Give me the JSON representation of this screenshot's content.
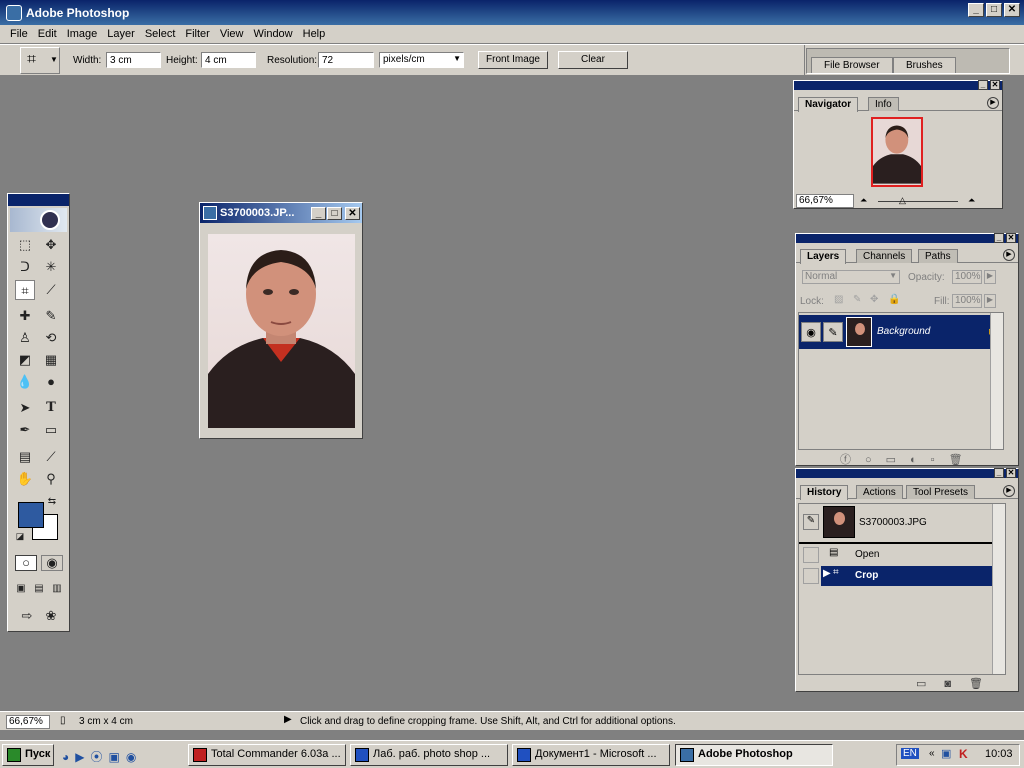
{
  "app": {
    "title": "Adobe Photoshop"
  },
  "menu": [
    "File",
    "Edit",
    "Image",
    "Layer",
    "Select",
    "Filter",
    "View",
    "Window",
    "Help"
  ],
  "options": {
    "width_label": "Width:",
    "width_value": "3 cm",
    "height_label": "Height:",
    "height_value": "4 cm",
    "resolution_label": "Resolution:",
    "resolution_value": "72",
    "units": "pixels/cm",
    "front_image": "Front Image",
    "clear": "Clear"
  },
  "well": {
    "file_browser": "File Browser",
    "brushes": "Brushes"
  },
  "navigator": {
    "tab_navigator": "Navigator",
    "tab_info": "Info",
    "zoom": "66,67%"
  },
  "layers": {
    "tab_layers": "Layers",
    "tab_channels": "Channels",
    "tab_paths": "Paths",
    "blend_mode": "Normal",
    "opacity_label": "Opacity:",
    "opacity_value": "100%",
    "lock_label": "Lock:",
    "fill_label": "Fill:",
    "fill_value": "100%",
    "layer_name": "Background"
  },
  "history": {
    "tab_history": "History",
    "tab_actions": "Actions",
    "tab_presets": "Tool Presets",
    "snapshot": "S3700003.JPG",
    "steps": [
      "Open",
      "Crop"
    ]
  },
  "document": {
    "title": "S3700003.JP..."
  },
  "colors": {
    "foreground": "#2e5aa0",
    "background": "#ffffff",
    "selection": "#0a246a"
  },
  "status": {
    "zoom": "66,67%",
    "doc_size": "3 cm x 4 cm",
    "message": "Click and drag to define cropping frame. Use Shift, Alt, and Ctrl for additional options."
  },
  "taskbar": {
    "start": "Пуск",
    "tasks": [
      "Total Commander 6.03a ...",
      "Лаб. раб. photo shop ...",
      "Документ1 - Microsoft ...",
      "Adobe Photoshop"
    ],
    "lang": "EN",
    "clock": "10:03"
  }
}
